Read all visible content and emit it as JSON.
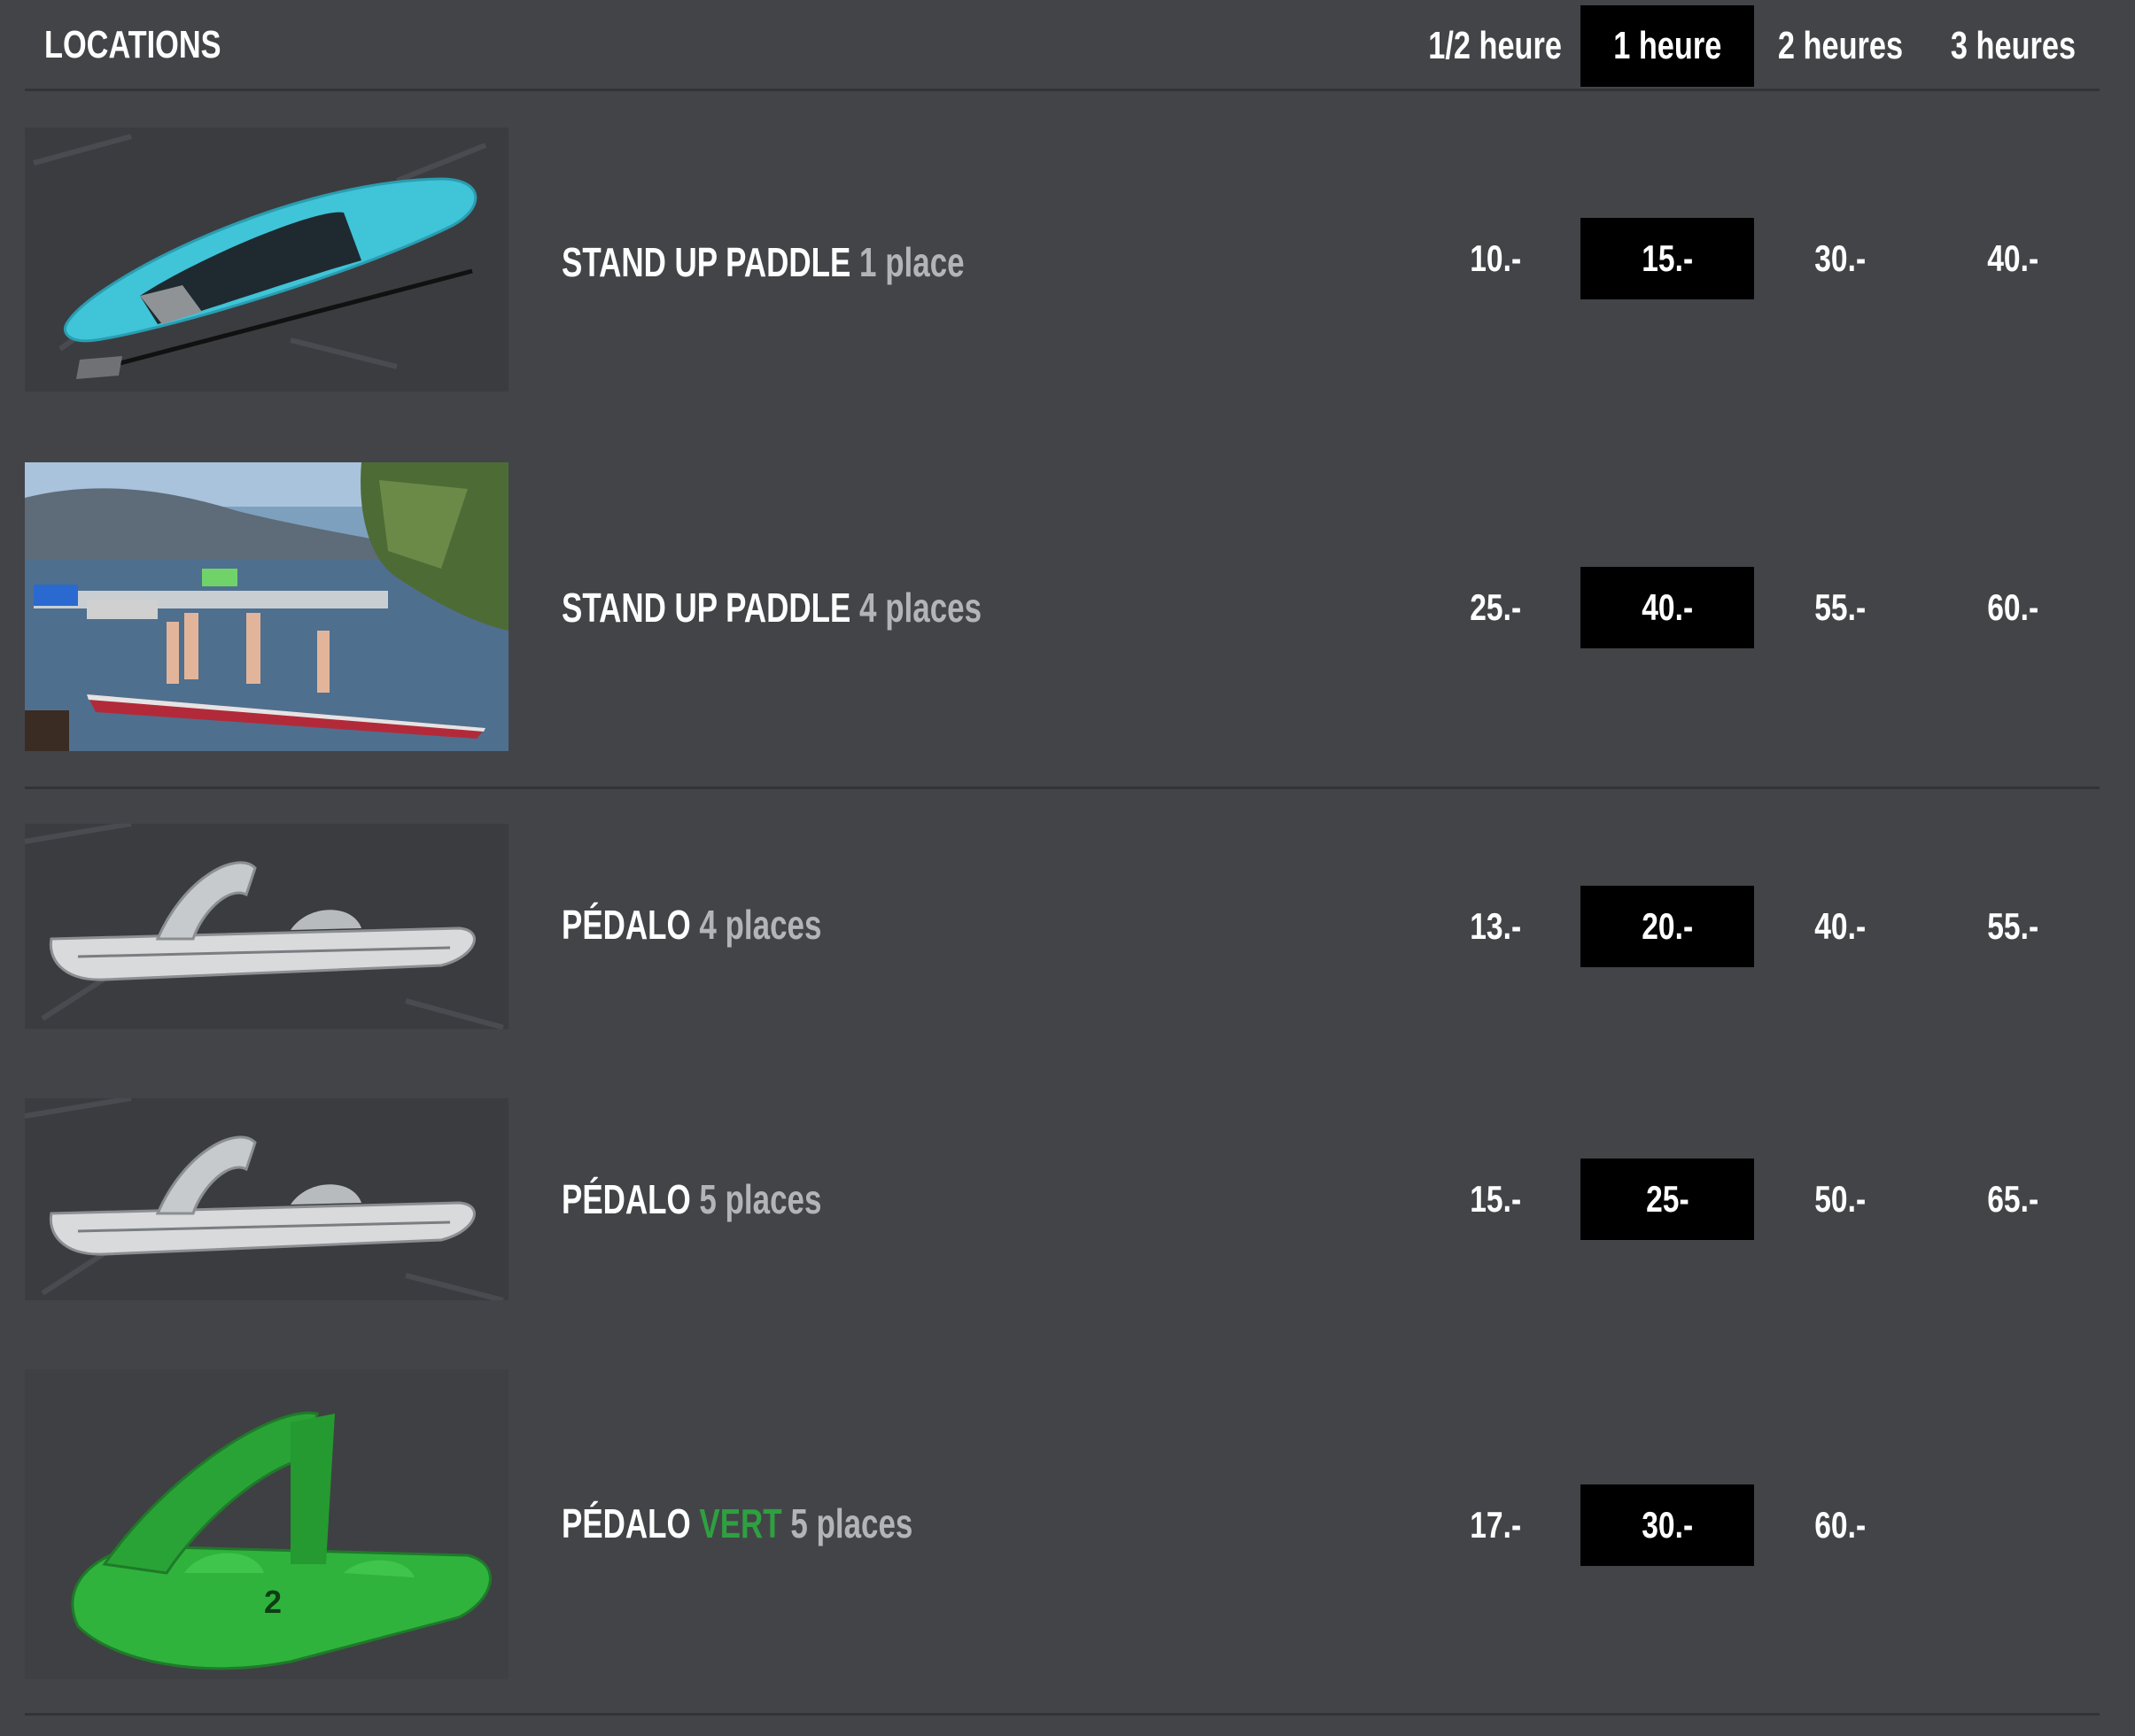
{
  "header": {
    "title": "LOCATIONS",
    "columns": [
      "1/2 heure",
      "1 heure",
      "2 heures",
      "3 heures"
    ],
    "highlighted_column": "1 heure"
  },
  "rows": [
    {
      "name": "STAND UP PADDLE",
      "variant": "",
      "capacity": "1 place",
      "image": "paddleboard-image",
      "prices": [
        "10.-",
        "15.-",
        "30.-",
        "40.-"
      ]
    },
    {
      "name": "STAND UP PADDLE",
      "variant": "",
      "capacity": "4 places",
      "image": "lake-paddle-photo",
      "prices": [
        "25.-",
        "40.-",
        "55.-",
        "60.-"
      ]
    },
    {
      "name": "PÉDALO",
      "variant": "",
      "capacity": "4 places",
      "image": "white-pedalo-image",
      "prices": [
        "13.-",
        "20.-",
        "40.-",
        "55.-"
      ]
    },
    {
      "name": "PÉDALO",
      "variant": "",
      "capacity": "5 places",
      "image": "white-pedalo-image",
      "prices": [
        "15.-",
        "25-",
        "50.-",
        "65.-"
      ]
    },
    {
      "name": "PÉDALO",
      "variant": "VERT",
      "capacity": "5 places",
      "image": "green-pedalo-image",
      "prices": [
        "17.-",
        "30.-",
        "60.-",
        ""
      ]
    }
  ],
  "colors": {
    "background": "#434448",
    "highlight": "#000000",
    "capacity_text": "#b3b4b8",
    "vert": "#2ea040",
    "divider": "#323337"
  }
}
